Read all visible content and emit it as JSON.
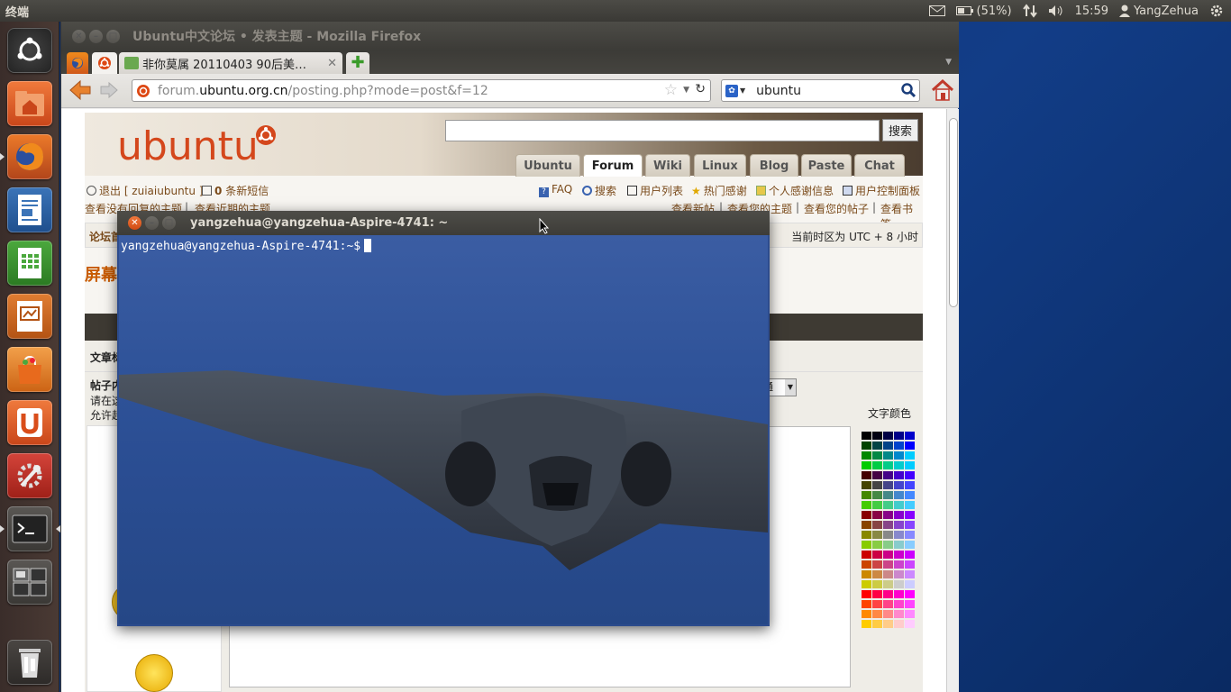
{
  "topbar": {
    "app_title": "终端",
    "battery": "(51%)",
    "time": "15:59",
    "user": "YangZehua",
    "icons": [
      "mail-icon",
      "battery-icon",
      "network-icon",
      "volume-icon",
      "user-icon",
      "power-gear-icon"
    ]
  },
  "launcher": {
    "items": [
      "dash-home",
      "home-folder",
      "firefox",
      "libreoffice-writer",
      "libreoffice-calc",
      "libreoffice-impress",
      "ubuntu-software-center",
      "ubuntu-one",
      "system-settings",
      "terminal",
      "workspace-switcher",
      "trash"
    ]
  },
  "firefox": {
    "window_title": "Ubuntu中文论坛 • 发表主题 - Mozilla Firefox",
    "tabs": [
      {
        "label": ""
      },
      {
        "label": "非你莫属 20110403 90后美…"
      }
    ],
    "url_domain_prefix": "forum.",
    "url_domain": "ubuntu.org.cn",
    "url_path": "/posting.php?mode=post&f=12",
    "search_text": "ubuntu"
  },
  "forum": {
    "logo": "ubuntu",
    "search_button": "搜索",
    "nav_tabs": [
      "Ubuntu",
      "Forum",
      "Wiki",
      "Linux",
      "Blog",
      "Paste",
      "Chat"
    ],
    "active_tab": "Forum",
    "logout": "退出 [ zuiaiubuntu ]",
    "new_messages_count": "0",
    "new_messages": "条新短信",
    "links": [
      "FAQ",
      "搜索",
      "用户列表",
      "热门感谢",
      "个人感谢信息",
      "用户控制面板"
    ],
    "row2_left": "查看没有回复的主题",
    "row2_left_sep": "|",
    "row2_left2": "查看近期的主题",
    "row2_right": [
      "查看新帖",
      "查看您的主题",
      "查看您的帖子",
      "查看书签"
    ],
    "breadcrumb": "论坛首",
    "timezone": "当前时区为 UTC + 8 小时",
    "page_title": "屏幕",
    "subject_label": "文章标",
    "body_label": "帖子内",
    "body_hint1": "请在这",
    "body_hint2": "允许超",
    "font_select": "通",
    "text_color_label": "文字颜色"
  },
  "terminal": {
    "title": "yangzehua@yangzehua-Aspire-4741: ~",
    "prompt": "yangzehua@yangzehua-Aspire-4741:~$"
  }
}
